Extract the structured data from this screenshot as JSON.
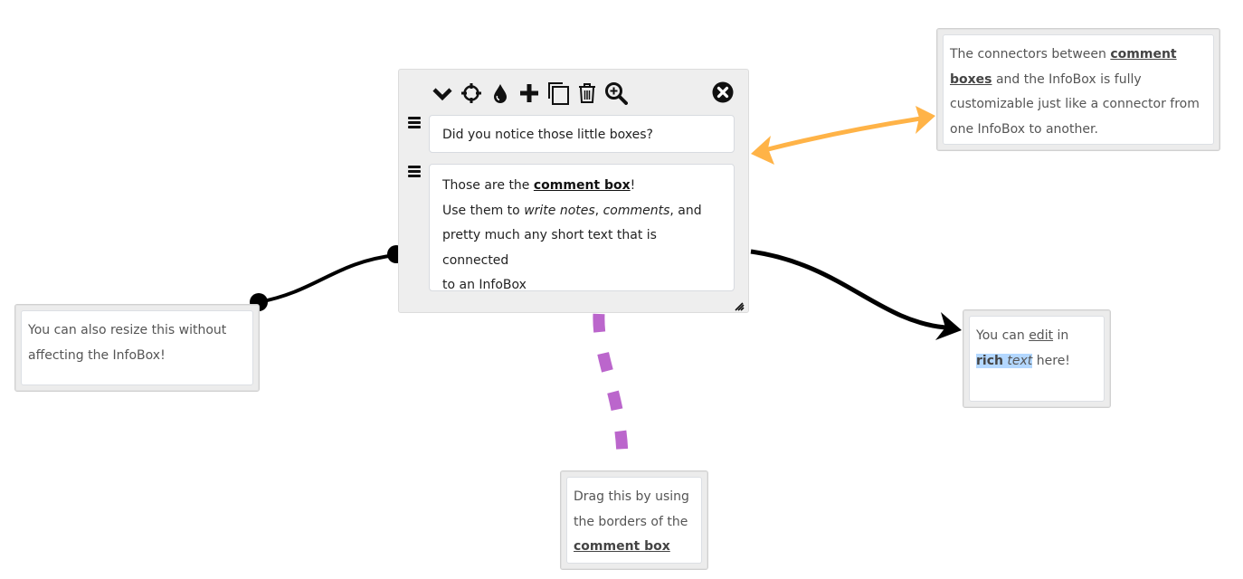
{
  "colors": {
    "infobox_bg": "#eeeeee",
    "connector_orange": "#ffb347",
    "connector_purple": "#bb66cc",
    "connector_black": "#000000",
    "highlight": "#b3d7ff"
  },
  "infobox": {
    "toolbar": [
      {
        "icon": "chevron-down-icon",
        "action": "collapse"
      },
      {
        "icon": "crosshair-icon",
        "action": "locate"
      },
      {
        "icon": "droplet-icon",
        "action": "color"
      },
      {
        "icon": "plus-icon",
        "action": "add"
      },
      {
        "icon": "copy-icon",
        "action": "duplicate"
      },
      {
        "icon": "trash-icon",
        "action": "delete"
      },
      {
        "icon": "zoom-in-icon",
        "action": "zoom"
      }
    ],
    "close_icon": "close-circle-icon",
    "field1": "Did you notice those little boxes?",
    "field2": {
      "line1_pre": "Those are the ",
      "line1_bold": "comment box",
      "line1_post": "!",
      "line2_pre": "Use them to ",
      "line2_italic1": "write notes",
      "line2_mid": ", ",
      "line2_italic2": "comments",
      "line2_post": ", and",
      "line3": "pretty much any short text that is connected",
      "line4": "to an InfoBox"
    }
  },
  "notes": {
    "top_right": {
      "pre": "The connectors between ",
      "bold": "comment boxes",
      "post": " and the InfoBox is fully customizable just like a connector from one InfoBox to another."
    },
    "left": {
      "text": "You can also resize this without affecting the InfoBox!"
    },
    "right": {
      "pre": "You can ",
      "underline": "edit",
      "mid": " in ",
      "bold": "rich",
      "space": " ",
      "italic": "text",
      "post": " here!"
    },
    "bottom": {
      "text": "Drag this by using the borders of the ",
      "bold": "comment box"
    }
  }
}
